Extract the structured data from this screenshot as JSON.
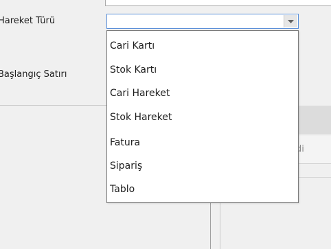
{
  "form": {
    "hareket_turu_label": "Hareket Türü",
    "baslangic_satiri_label": "Başlangıç Satırı"
  },
  "combo": {
    "value": "",
    "arrow_icon": "chevron-down-icon"
  },
  "dropdown": {
    "items": [
      {
        "label": "Cari Kartı"
      },
      {
        "label": "Stok Kartı"
      },
      {
        "label": "Cari Hareket"
      },
      {
        "label": "Stok Hareket"
      },
      {
        "label": "Fatura"
      },
      {
        "label": "Sipariş"
      },
      {
        "label": "Tablo"
      }
    ]
  },
  "panel": {
    "partial_text": "di"
  }
}
